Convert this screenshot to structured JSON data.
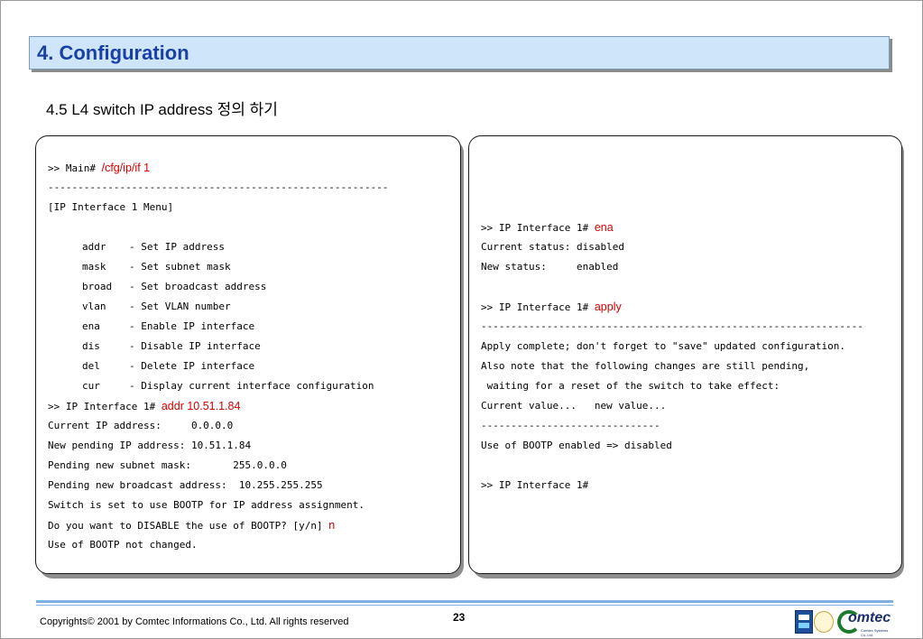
{
  "header": {
    "title": "4. Configuration",
    "subtitle": "4.5 L4 switch IP address 정의 하기"
  },
  "left_panel": {
    "prompt1": ">> Main# ",
    "cmd1": "/cfg/ip/if 1",
    "divider": "---------------------------------------------------------",
    "menu_title": "[IP Interface 1 Menu]",
    "menu": [
      {
        "key": "addr",
        "desc": "- Set IP address"
      },
      {
        "key": "mask",
        "desc": "- Set subnet mask"
      },
      {
        "key": "broad",
        "desc": "- Set broadcast address"
      },
      {
        "key": "vlan",
        "desc": "- Set VLAN number"
      },
      {
        "key": "ena",
        "desc": "- Enable IP interface"
      },
      {
        "key": "dis",
        "desc": "- Disable IP interface"
      },
      {
        "key": "del",
        "desc": "- Delete IP interface"
      },
      {
        "key": "cur",
        "desc": "- Display current interface configuration"
      }
    ],
    "prompt2": ">> IP Interface 1# ",
    "cmd2": "addr 10.51.1.84",
    "lines": [
      "Current IP address:     0.0.0.0",
      "New pending IP address: 10.51.1.84",
      "Pending new subnet mask:       255.0.0.0",
      "Pending new broadcast address:  10.255.255.255",
      "Switch is set to use BOOTP for IP address assignment."
    ],
    "question": "Do you want to DISABLE the use of BOOTP? [y/n] ",
    "answer": "n",
    "last": "Use of BOOTP not changed."
  },
  "right_panel": {
    "prompt1": ">> IP Interface 1# ",
    "cmd1": "ena",
    "status1": "Current status: disabled",
    "status2": "New status:     enabled",
    "prompt2": ">> IP Interface 1# ",
    "cmd2": "apply",
    "divider": "----------------------------------------------------------------",
    "lines": [
      "Apply complete; don't forget to \"save\" updated configuration.",
      "Also note that the following changes are still pending,",
      " waiting for a reset of the switch to take effect:",
      "Current value...   new value...",
      "------------------------------",
      "Use of BOOTP enabled => disabled"
    ],
    "prompt3": ">> IP Interface 1#"
  },
  "footer": {
    "copyright": "Copyrights© 2001 by Comtec Informations Co., Ltd. All rights reserved",
    "page_number": "23",
    "logo_word": "omtec",
    "logo_tagline": "Comtec Systems Co.,Ltd."
  },
  "colors": {
    "title_bg": "#cfe6fa",
    "title_text": "#1a3fa5",
    "command_red": "#d40000",
    "footer_rule": "#7fb0e3"
  }
}
